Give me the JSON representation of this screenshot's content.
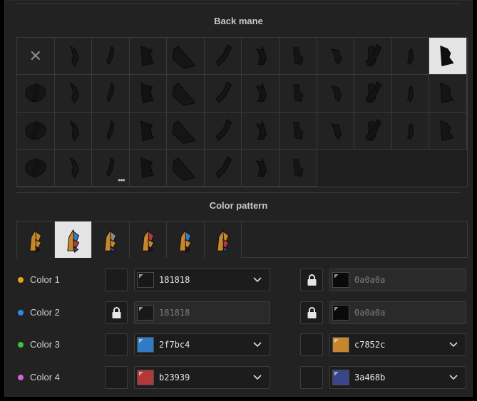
{
  "back_mane": {
    "title": "Back mane",
    "rows": 4,
    "cols": 12,
    "selected_index": 11,
    "more_index": 38,
    "more_glyph": "•••",
    "cells": [
      {
        "name": "none-option",
        "icon": "x-icon",
        "glyph": "✕"
      },
      {
        "icon": "back-mane-style-icon"
      },
      {
        "icon": "back-mane-style-icon"
      },
      {
        "icon": "back-mane-style-icon"
      },
      {
        "icon": "back-mane-style-icon"
      },
      {
        "icon": "back-mane-style-icon"
      },
      {
        "icon": "back-mane-style-icon"
      },
      {
        "icon": "back-mane-style-icon"
      },
      {
        "icon": "back-mane-style-icon"
      },
      {
        "icon": "back-mane-style-icon"
      },
      {
        "icon": "back-mane-style-icon"
      },
      {
        "icon": "back-mane-style-icon"
      },
      {
        "icon": "back-mane-style-icon"
      },
      {
        "icon": "back-mane-style-icon"
      },
      {
        "icon": "back-mane-style-icon"
      },
      {
        "icon": "back-mane-style-icon"
      },
      {
        "icon": "back-mane-style-icon"
      },
      {
        "icon": "back-mane-style-icon"
      },
      {
        "icon": "back-mane-style-icon"
      },
      {
        "icon": "back-mane-style-icon"
      },
      {
        "icon": "back-mane-style-icon"
      },
      {
        "icon": "back-mane-style-icon"
      },
      {
        "icon": "back-mane-style-icon"
      },
      {
        "icon": "back-mane-style-icon"
      },
      {
        "icon": "back-mane-style-icon"
      },
      {
        "icon": "back-mane-style-icon"
      },
      {
        "icon": "back-mane-style-icon"
      },
      {
        "icon": "back-mane-style-icon"
      },
      {
        "icon": "back-mane-style-icon"
      },
      {
        "icon": "back-mane-style-icon"
      },
      {
        "icon": "back-mane-style-icon"
      },
      {
        "icon": "back-mane-style-icon"
      },
      {
        "icon": "back-mane-style-icon"
      },
      {
        "icon": "back-mane-style-icon"
      },
      {
        "icon": "back-mane-style-icon"
      },
      {
        "icon": "back-mane-style-icon"
      },
      {
        "icon": "back-mane-style-icon"
      },
      {
        "icon": "back-mane-style-icon"
      },
      {
        "icon": "back-mane-style-icon"
      },
      {
        "icon": "back-mane-style-icon"
      },
      {
        "icon": "back-mane-style-icon"
      },
      {
        "icon": "back-mane-style-icon"
      },
      {
        "icon": "back-mane-style-icon"
      },
      {
        "icon": "back-mane-style-icon"
      }
    ]
  },
  "color_pattern": {
    "title": "Color pattern",
    "selected_index": 1,
    "patterns": [
      {
        "icon": "pattern-icon",
        "colors": [
          "#c7852c",
          "#c7852c",
          "#c7852c",
          "#181818"
        ]
      },
      {
        "icon": "pattern-icon",
        "colors": [
          "#c7852c",
          "#2f7bc4",
          "#b23939",
          "#3a468b"
        ]
      },
      {
        "icon": "pattern-icon",
        "colors": [
          "#c7852c",
          "#8a8a8a",
          "#c7852c",
          "#3a468b"
        ]
      },
      {
        "icon": "pattern-icon",
        "colors": [
          "#c7852c",
          "#b23939",
          "#c7852c",
          "#181818"
        ]
      },
      {
        "icon": "pattern-icon",
        "colors": [
          "#c7852c",
          "#2f7bc4",
          "#c7852c",
          "#181818"
        ]
      },
      {
        "icon": "pattern-icon",
        "colors": [
          "#c7852c",
          "#c7852c",
          "#b23939",
          "#3a468b"
        ]
      }
    ]
  },
  "colors": [
    {
      "label": "Color 1",
      "dot": "#e8a020",
      "primary": {
        "value": "181818",
        "swatch": "#181818",
        "locked": false,
        "disabled": false
      },
      "secondary": {
        "value": "0a0a0a",
        "swatch": "#0a0a0a",
        "locked": true,
        "disabled": true
      }
    },
    {
      "label": "Color 2",
      "dot": "#2f8ae8",
      "primary": {
        "value": "181818",
        "swatch": "#181818",
        "locked": true,
        "disabled": true
      },
      "secondary": {
        "value": "0a0a0a",
        "swatch": "#0a0a0a",
        "locked": true,
        "disabled": true
      }
    },
    {
      "label": "Color 3",
      "dot": "#3cc23c",
      "primary": {
        "value": "2f7bc4",
        "swatch": "#2f7bc4",
        "locked": false,
        "disabled": false
      },
      "secondary": {
        "value": "c7852c",
        "swatch": "#c7852c",
        "locked": false,
        "disabled": false
      }
    },
    {
      "label": "Color 4",
      "dot": "#d860d0",
      "primary": {
        "value": "b23939",
        "swatch": "#b23939",
        "locked": false,
        "disabled": false
      },
      "secondary": {
        "value": "3a468b",
        "swatch": "#3a468b",
        "locked": false,
        "disabled": false
      }
    }
  ]
}
